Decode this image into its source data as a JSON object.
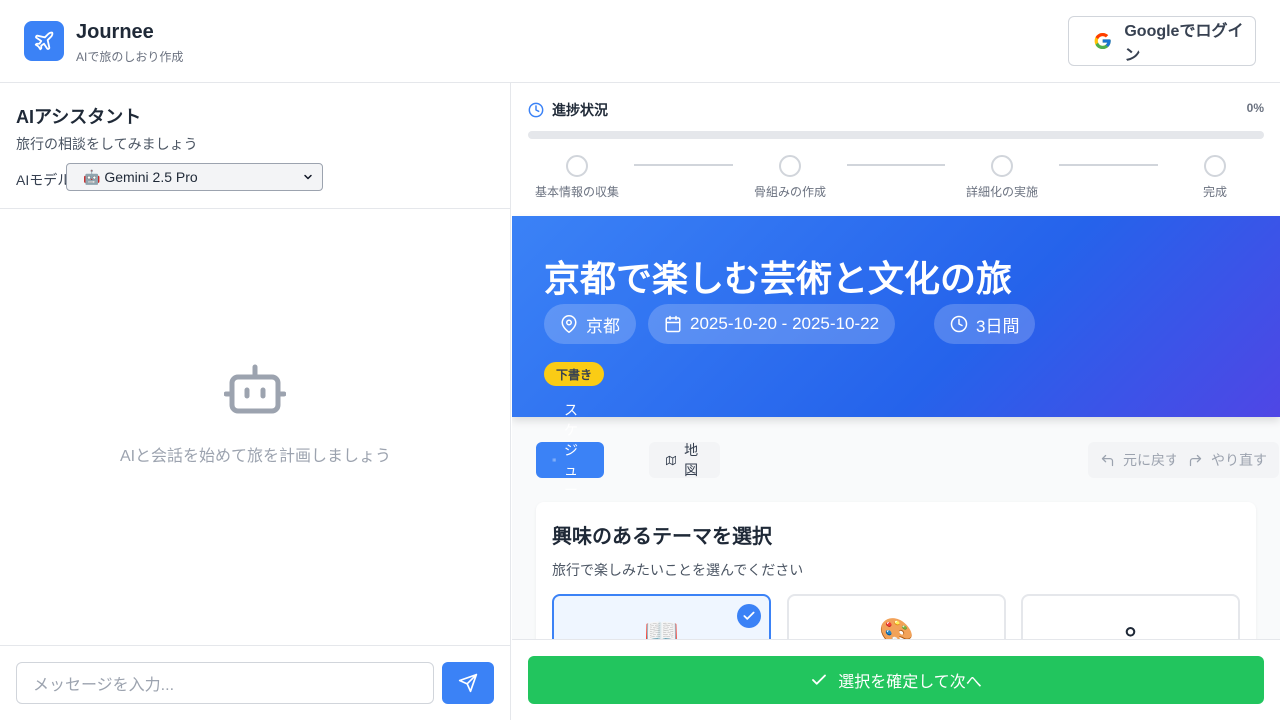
{
  "header": {
    "brand_name": "Journee",
    "brand_subtitle": "AIで旅のしおり作成",
    "google_button": "Googleでログイン"
  },
  "chat": {
    "title": "AIアシスタント",
    "description": "旅行の相談をしてみましょう",
    "model_label": "AIモデル:",
    "model_selected": "🤖 Gemini 2.5 Pro",
    "empty_message": "AIと会話を始めて旅を計画しましょう",
    "input_placeholder": "メッセージを入力..."
  },
  "progress": {
    "label": "進捗状況",
    "percent_text": "0%",
    "percent_value": 0,
    "steps": [
      {
        "label": "基本情報の収集"
      },
      {
        "label": "骨組みの作成"
      },
      {
        "label": "詳細化の実施"
      },
      {
        "label": "完成"
      }
    ]
  },
  "trip": {
    "title": "京都で楽しむ芸術と文化の旅",
    "location": "京都",
    "dates": "2025-10-20 - 2025-10-22",
    "duration": "3日間",
    "status_badge": "下書き"
  },
  "tabs": {
    "schedule": "スケジュール",
    "map": "地図",
    "undo": "元に戻す",
    "redo": "やり直す"
  },
  "interests": {
    "title": "興味のあるテーマを選択",
    "description": "旅行で楽しみたいことを選んでください",
    "options": [
      {
        "emoji": "📖",
        "selected": true
      },
      {
        "emoji": "🎨",
        "selected": false
      },
      {
        "emoji": "⚬",
        "selected": false
      }
    ]
  },
  "confirm_button": "選択を確定して次へ",
  "colors": {
    "primary": "#3b82f6",
    "success": "#22c55e",
    "badge": "#facc15"
  }
}
